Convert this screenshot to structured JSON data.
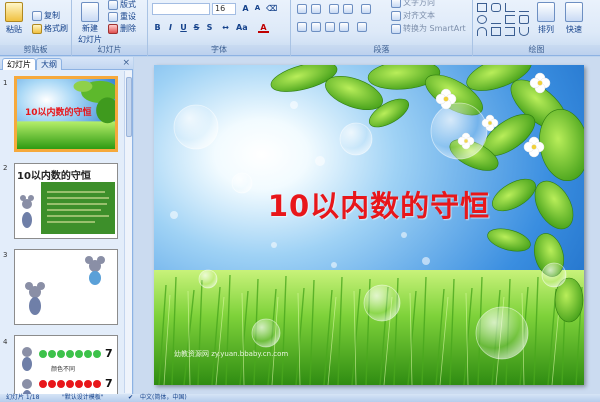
{
  "ribbon": {
    "clipboard": {
      "paste": "粘贴",
      "copy": "复制",
      "format_painter": "格式刷",
      "label": "剪贴板"
    },
    "slides": {
      "new_slide": "新建",
      "new_slide_2": "幻灯片",
      "layout": "版式",
      "reset": "重设",
      "delete": "删除",
      "label": "幻灯片"
    },
    "font": {
      "size": "16",
      "bold": "B",
      "italic": "I",
      "underline": "U",
      "strike": "S",
      "shadow": "S",
      "label": "字体"
    },
    "paragraph": {
      "text_direction": "文字方向",
      "align_text": "对齐文本",
      "smartart": "转换为 SmartArt",
      "label": "段落"
    },
    "drawing": {
      "arrange": "排列",
      "quick_styles": "快速",
      "label": "绘图"
    }
  },
  "panel": {
    "tabs": [
      "幻灯片",
      "大纲"
    ],
    "close": "×",
    "slides": [
      {
        "num": "1",
        "title": "10以内数的守恒"
      },
      {
        "num": "2",
        "title": "10以内数的守恒"
      },
      {
        "num": "3",
        "title": ""
      },
      {
        "num": "4",
        "title": "",
        "count_a": "7",
        "count_b": "7",
        "caption": "颜色不同"
      }
    ]
  },
  "slide": {
    "title": "10以内数的守恒",
    "watermark": "幼教资源网 zy.yuan.bbaby.cn.com"
  },
  "status": {
    "slide_count": "幻灯片 1/18",
    "theme": "\"默认设计模板\"",
    "language": "中文(简体，中国)"
  }
}
